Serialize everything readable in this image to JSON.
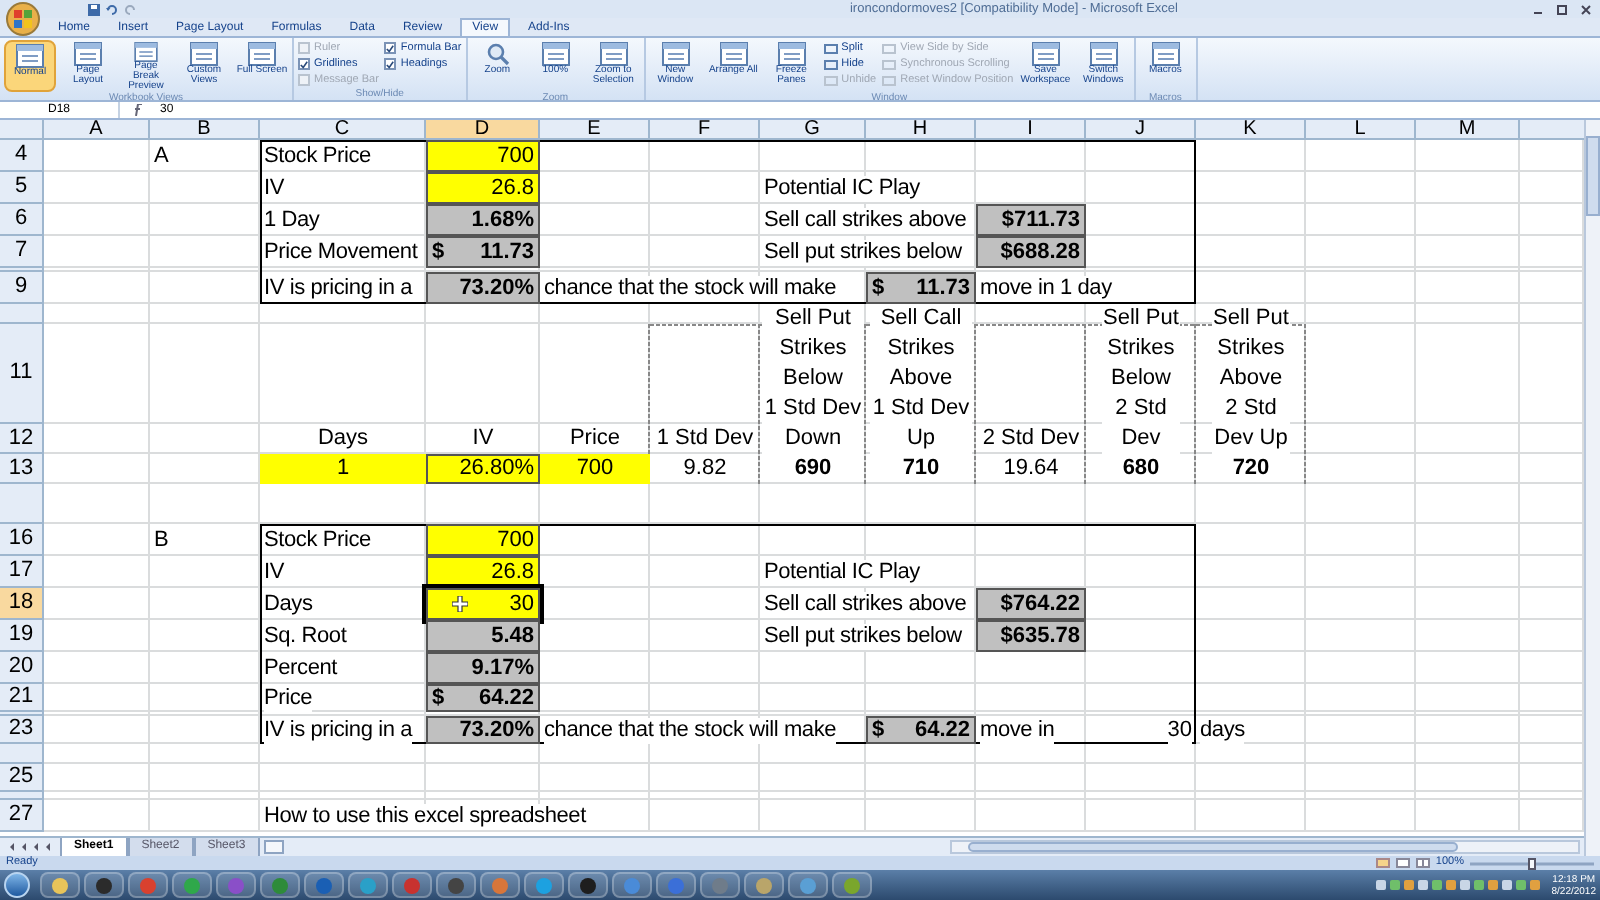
{
  "window": {
    "title": "ironcondormoves2 [Compatibility Mode] - Microsoft Excel"
  },
  "ribbon": {
    "tabs": [
      {
        "label": "Home",
        "selected": false
      },
      {
        "label": "Insert",
        "selected": false
      },
      {
        "label": "Page Layout",
        "selected": false
      },
      {
        "label": "Formulas",
        "selected": false
      },
      {
        "label": "Data",
        "selected": false
      },
      {
        "label": "Review",
        "selected": false
      },
      {
        "label": "View",
        "selected": true
      },
      {
        "label": "Add-Ins",
        "selected": false
      }
    ],
    "groups": [
      {
        "label": "Workbook Views",
        "items": [
          {
            "kind": "large",
            "label": "Normal",
            "selected": true
          },
          {
            "kind": "large",
            "label": "Page Layout",
            "selected": false
          },
          {
            "kind": "large",
            "label": "Page Break Preview",
            "selected": false
          },
          {
            "kind": "large",
            "label": "Custom Views",
            "selected": false
          },
          {
            "kind": "large",
            "label": "Full Screen",
            "selected": false
          }
        ]
      },
      {
        "label": "Show/Hide",
        "items": [
          {
            "kind": "check",
            "label": "Ruler",
            "checked": false,
            "disabled": true
          },
          {
            "kind": "check",
            "label": "Gridlines",
            "checked": true,
            "disabled": false
          },
          {
            "kind": "check",
            "label": "Message Bar",
            "checked": false,
            "disabled": true
          },
          {
            "kind": "check",
            "label": "Formula Bar",
            "checked": true,
            "disabled": false
          },
          {
            "kind": "check",
            "label": "Headings",
            "checked": true,
            "disabled": false
          }
        ]
      },
      {
        "label": "Zoom",
        "items": [
          {
            "kind": "zoom",
            "label": "Zoom",
            "selected": false
          },
          {
            "kind": "large",
            "label": "100%",
            "selected": false
          },
          {
            "kind": "large",
            "label": "Zoom to Selection",
            "selected": false
          }
        ]
      },
      {
        "label": "Window",
        "items": [
          {
            "kind": "large",
            "label": "New Window",
            "selected": false
          },
          {
            "kind": "large",
            "label": "Arrange All",
            "selected": false
          },
          {
            "kind": "large",
            "label": "Freeze Panes",
            "selected": false
          },
          {
            "kind": "small",
            "label": "Split",
            "disabled": false
          },
          {
            "kind": "small",
            "label": "Hide",
            "disabled": false
          },
          {
            "kind": "small",
            "label": "Unhide",
            "disabled": true
          },
          {
            "kind": "small",
            "label": "View Side by Side",
            "disabled": true
          },
          {
            "kind": "small",
            "label": "Synchronous Scrolling",
            "disabled": true
          },
          {
            "kind": "small",
            "label": "Reset Window Position",
            "disabled": true
          },
          {
            "kind": "large",
            "label": "Save Workspace",
            "selected": false
          },
          {
            "kind": "large",
            "label": "Switch Windows",
            "selected": false
          }
        ]
      },
      {
        "label": "Macros",
        "items": [
          {
            "kind": "large",
            "label": "Macros",
            "selected": false
          }
        ]
      }
    ]
  },
  "formula_bar": {
    "name_box": "D18",
    "value": "30"
  },
  "sheet": {
    "columns": [
      {
        "label": "A",
        "selected": false
      },
      {
        "label": "B",
        "selected": false
      },
      {
        "label": "C",
        "selected": false
      },
      {
        "label": "D",
        "selected": true
      },
      {
        "label": "E",
        "selected": false
      },
      {
        "label": "F",
        "selected": false
      },
      {
        "label": "G",
        "selected": false
      },
      {
        "label": "H",
        "selected": false
      },
      {
        "label": "I",
        "selected": false
      },
      {
        "label": "J",
        "selected": false
      },
      {
        "label": "K",
        "selected": false
      },
      {
        "label": "L",
        "selected": false
      },
      {
        "label": "M",
        "selected": false
      }
    ],
    "rows": [
      {
        "number": "4",
        "selected": false,
        "cells": {
          "B": {
            "kind": "label",
            "text": "A"
          },
          "C": {
            "kind": "label",
            "text": "Stock Price"
          },
          "D": {
            "kind": "input",
            "text": "700",
            "color": "#ffff00"
          }
        }
      },
      {
        "number": "5",
        "selected": false,
        "cells": {
          "C": {
            "kind": "label",
            "text": "IV"
          },
          "D": {
            "kind": "input",
            "text": "26.8",
            "color": "#ffff00"
          },
          "G": {
            "kind": "label",
            "text": "Potential IC Play"
          }
        }
      },
      {
        "number": "6",
        "selected": false,
        "cells": {
          "C": {
            "kind": "label",
            "text": "1 Day"
          },
          "D": {
            "kind": "output",
            "text": "1.68%",
            "color": "#c0c0c0"
          },
          "G": {
            "kind": "label",
            "text": "Sell call strikes above"
          },
          "I": {
            "kind": "output",
            "text": "$711.73",
            "color": "#c0c0c0"
          }
        }
      },
      {
        "number": "7",
        "selected": false,
        "cells": {
          "C": {
            "kind": "label",
            "text": "Price Movement"
          },
          "D": {
            "kind": "currency",
            "currency": "$",
            "text": "11.73",
            "color": "#c0c0c0"
          },
          "G": {
            "kind": "label",
            "text": "Sell put strikes below"
          },
          "I": {
            "kind": "output",
            "text": "$688.28",
            "color": "#c0c0c0"
          }
        }
      },
      {
        "number": "9",
        "selected": false,
        "cells": {
          "C": {
            "kind": "label",
            "text": "IV is pricing in a"
          },
          "D": {
            "kind": "output",
            "text": "73.20%",
            "color": "#c0c0c0"
          },
          "E": {
            "kind": "label",
            "text": "chance that the stock will make"
          },
          "H": {
            "kind": "currency",
            "currency": "$",
            "text": "11.73",
            "color": "#c0c0c0"
          },
          "I": {
            "kind": "label",
            "text": "move in 1 day"
          }
        }
      },
      {
        "number": "11",
        "selected": false,
        "cells": {}
      },
      {
        "number": "12",
        "selected": false,
        "cells": {
          "C": {
            "kind": "value",
            "text": "Days"
          },
          "D": {
            "kind": "value",
            "text": "IV"
          },
          "E": {
            "kind": "value",
            "text": "Price"
          },
          "F": {
            "kind": "value",
            "text": "1 Std Dev"
          },
          "G": {
            "kind": "heading",
            "text": "Sell Put\nStrikes\nBelow\n1 Std Dev\nDown"
          },
          "H": {
            "kind": "heading",
            "text": "Sell Call\nStrikes\nAbove\n1 Std Dev\nUp"
          },
          "I": {
            "kind": "value",
            "text": "2 Std Dev"
          },
          "J": {
            "kind": "heading",
            "text": "Sell Put\nStrikes\nBelow\n2 Std\nDev"
          },
          "K": {
            "kind": "heading",
            "text": "Sell Put\nStrikes\nAbove\n2 Std\nDev Up"
          }
        }
      },
      {
        "number": "13",
        "selected": false,
        "cells": {
          "C": {
            "kind": "value",
            "text": "1",
            "color": "#ffff00"
          },
          "D": {
            "kind": "input",
            "text": "26.80%",
            "color": "#ffff00"
          },
          "E": {
            "kind": "value",
            "text": "700",
            "color": "#ffff00"
          },
          "F": {
            "kind": "value",
            "text": "9.82"
          },
          "G": {
            "kind": "key",
            "text": "690"
          },
          "H": {
            "kind": "key",
            "text": "710"
          },
          "I": {
            "kind": "value",
            "text": "19.64"
          },
          "J": {
            "kind": "key",
            "text": "680"
          },
          "K": {
            "kind": "key",
            "text": "720"
          }
        }
      },
      {
        "number": "16",
        "selected": false,
        "cells": {
          "B": {
            "kind": "label",
            "text": "B"
          },
          "C": {
            "kind": "label",
            "text": "Stock Price"
          },
          "D": {
            "kind": "input",
            "text": "700",
            "color": "#ffff00"
          }
        }
      },
      {
        "number": "17",
        "selected": false,
        "cells": {
          "C": {
            "kind": "label",
            "text": "IV"
          },
          "D": {
            "kind": "input",
            "text": "26.8",
            "color": "#ffff00"
          },
          "G": {
            "kind": "label",
            "text": "Potential IC Play"
          }
        }
      },
      {
        "number": "18",
        "selected": true,
        "cells": {
          "C": {
            "kind": "label",
            "text": "Days"
          },
          "D": {
            "kind": "input",
            "text": "30",
            "color": "#ffff00"
          },
          "G": {
            "kind": "label",
            "text": "Sell call strikes above"
          },
          "I": {
            "kind": "output",
            "text": "$764.22",
            "color": "#c0c0c0"
          }
        }
      },
      {
        "number": "19",
        "selected": false,
        "cells": {
          "C": {
            "kind": "label",
            "text": "Sq. Root"
          },
          "D": {
            "kind": "output",
            "text": "5.48",
            "color": "#c0c0c0"
          },
          "G": {
            "kind": "label",
            "text": "Sell put strikes below"
          },
          "I": {
            "kind": "output",
            "text": "$635.78",
            "color": "#c0c0c0"
          }
        }
      },
      {
        "number": "20",
        "selected": false,
        "cells": {
          "C": {
            "kind": "label",
            "text": "Percent"
          },
          "D": {
            "kind": "output",
            "text": "9.17%",
            "color": "#c0c0c0"
          }
        }
      },
      {
        "number": "21",
        "selected": false,
        "cells": {
          "C": {
            "kind": "label",
            "text": "Price"
          },
          "D": {
            "kind": "currency",
            "currency": "$",
            "text": "64.22",
            "color": "#c0c0c0"
          }
        }
      },
      {
        "number": "23",
        "selected": false,
        "cells": {
          "C": {
            "kind": "label",
            "text": "IV is pricing in a"
          },
          "D": {
            "kind": "output",
            "text": "73.20%",
            "color": "#c0c0c0"
          },
          "E": {
            "kind": "label",
            "text": "chance that the stock will make"
          },
          "H": {
            "kind": "currency",
            "currency": "$",
            "text": "64.22",
            "color": "#c0c0c0"
          },
          "I": {
            "kind": "label",
            "text": "move in"
          },
          "J": {
            "kind": "number",
            "text": "30"
          },
          "K": {
            "kind": "label",
            "text": "days"
          }
        }
      },
      {
        "number": "25",
        "selected": false,
        "cells": {}
      },
      {
        "number": "27",
        "selected": false,
        "cells": {
          "C": {
            "kind": "label",
            "text": "How to use this excel spreadsheet"
          }
        }
      }
    ],
    "tabs": [
      {
        "label": "Sheet1",
        "selected": true
      },
      {
        "label": "Sheet2",
        "selected": false
      },
      {
        "label": "Sheet3",
        "selected": false
      }
    ]
  },
  "status_bar": {
    "status": "Ready",
    "zoom": "100%"
  },
  "taskbar": {
    "apps": [
      {
        "color": "#e8c45a"
      },
      {
        "color": "#2b2b2b"
      },
      {
        "color": "#d9412f"
      },
      {
        "color": "#2fa84a"
      },
      {
        "color": "#8a4fc8"
      },
      {
        "color": "#2e8b3a"
      },
      {
        "color": "#1a5fb4"
      },
      {
        "color": "#2aa0c8"
      },
      {
        "color": "#c8322f"
      },
      {
        "color": "#444444"
      },
      {
        "color": "#d8763a"
      },
      {
        "color": "#1da1e0"
      },
      {
        "color": "#1e1e1e"
      },
      {
        "color": "#4a8bd8"
      },
      {
        "color": "#3b6fd8"
      },
      {
        "color": "#6f7c8a"
      },
      {
        "color": "#b9a56a"
      },
      {
        "color": "#5a9fd4"
      },
      {
        "color": "#7aa62c"
      }
    ],
    "clock": {
      "time": "12:18 PM",
      "date": "8/22/2012"
    }
  }
}
